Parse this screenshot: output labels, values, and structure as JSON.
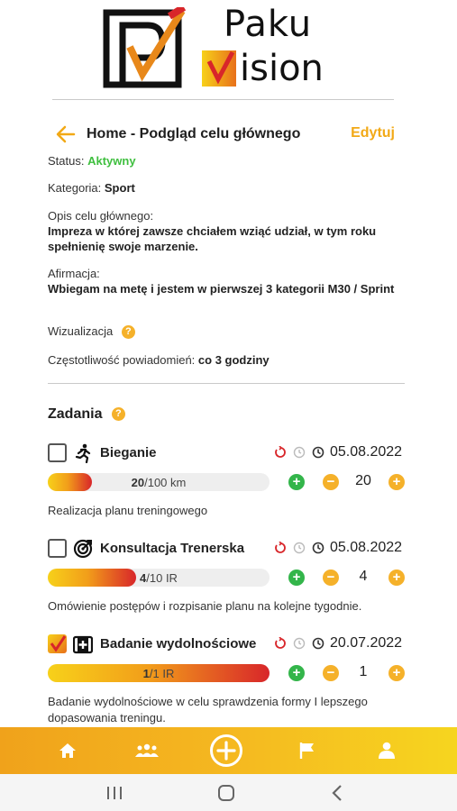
{
  "logo": {
    "line1": "Paku",
    "line2": "ision"
  },
  "header": {
    "title": "Home - Podgląd celu głównego",
    "edit_label": "Edytuj"
  },
  "goal": {
    "status_label": "Status:",
    "status_value": "Aktywny",
    "category_label": "Kategoria:",
    "category_value": "Sport",
    "description_label": "Opis celu głównego:",
    "description_value": "Impreza w której zawsze chciałem wziąć udział, w tym roku spełnienię swoje marzenie.",
    "affirmation_label": "Afirmacja:",
    "affirmation_value": "Wbiegam na metę i jestem w pierwszej 3 kategorii M30 / Sprint",
    "visualization_label": "Wizualizacja",
    "frequency_label": "Częstotliwość powiadomień:",
    "frequency_value": "co 3 godziny"
  },
  "tasks_title": "Zadania",
  "tasks": [
    {
      "name": "Bieganie",
      "icon": "runner-icon",
      "checked": false,
      "date": "05.08.2022",
      "progress_current": "20",
      "progress_rest": "/100 km",
      "progress_fraction": 0.2,
      "quantity": "20",
      "description": "Realizacja planu treningowego"
    },
    {
      "name": "Konsultacja Trenerska",
      "icon": "target-icon",
      "checked": false,
      "date": "05.08.2022",
      "progress_current": "4",
      "progress_rest": "/10 IR",
      "progress_fraction": 0.4,
      "quantity": "4",
      "description": "Omówienie postępów i rozpisanie planu na kolejne tygodnie."
    },
    {
      "name": "Badanie wydolnościowe",
      "icon": "medical-kit-icon",
      "checked": true,
      "date": "20.07.2022",
      "progress_current": "1",
      "progress_rest": "/1 IR",
      "progress_fraction": 1.0,
      "quantity": "1",
      "description": "Badanie wydolnościowe w celu sprawdzenia formy I lepszego dopasowania treningu."
    }
  ],
  "colors": {
    "accent": "#f2a916",
    "status_active": "#3fbf3f",
    "plus_green": "#33b54a",
    "nav_gradient_start": "#f0a21b",
    "nav_gradient_end": "#f6d51f"
  },
  "bottom_nav": [
    "home-icon",
    "people-icon",
    "add-circle-icon",
    "flag-icon",
    "profile-icon"
  ]
}
